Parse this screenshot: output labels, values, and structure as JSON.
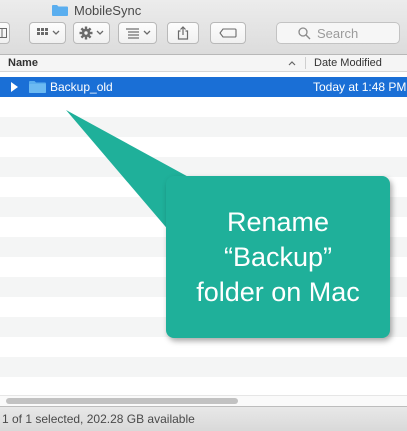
{
  "window": {
    "title": "MobileSync"
  },
  "toolbar": {
    "search_placeholder": "Search"
  },
  "columns": {
    "name": "Name",
    "date_modified": "Date Modified"
  },
  "files": [
    {
      "name": "Backup_old",
      "date": "Today at 1:48 PM",
      "kind": "folder",
      "selected": true
    }
  ],
  "status": {
    "text": "1 of 1 selected, 202.28 GB available"
  },
  "callout": {
    "text": "Rename\n“Backup”\nfolder on Mac"
  },
  "colors": {
    "selection": "#1a6fd6",
    "folder": "#5aaeef",
    "callout": "#1fb09a"
  }
}
